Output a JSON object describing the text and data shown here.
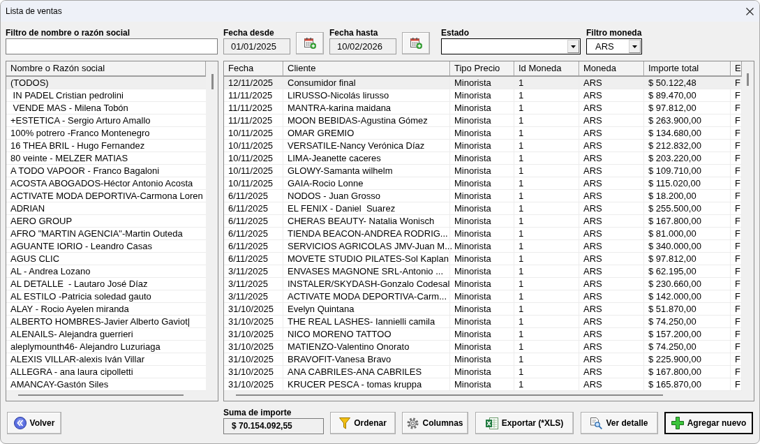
{
  "window": {
    "title": "Lista de ventas"
  },
  "filters": {
    "name": {
      "label": "Filtro de nombre o razón social"
    },
    "date_from": {
      "label": "Fecha desde",
      "value": "01/01/2025"
    },
    "date_to": {
      "label": "Fecha hasta",
      "value": "10/02/2026"
    },
    "status": {
      "label": "Estado"
    },
    "currency": {
      "label": "Filtro moneda",
      "value": "ARS"
    }
  },
  "clients_list": {
    "header": "Nombre o Razón social",
    "items": [
      {
        "name": "(TODOS)",
        "selected": true
      },
      {
        "name": " IN PADEL Cristian pedrolini",
        "selected": false
      },
      {
        "name": " VENDE MAS - Milena Tobón",
        "selected": false
      },
      {
        "name": "+ESTETICA - Sergio Arturo Amallo",
        "selected": false
      },
      {
        "name": "100% potrero -Franco Montenegro",
        "selected": false
      },
      {
        "name": "16 THEA BRIL - Hugo Fernandez",
        "selected": false
      },
      {
        "name": "80 veinte - MELZER MATIAS",
        "selected": false
      },
      {
        "name": "A TODO VAPOOR - Franco Bagaloni",
        "selected": false
      },
      {
        "name": "ACOSTA ABOGADOS-Héctor Antonio Acosta",
        "selected": false
      },
      {
        "name": "ACTIVATE MODA DEPORTIVA-Carmona Loren",
        "selected": false
      },
      {
        "name": "ADRIAN",
        "selected": false
      },
      {
        "name": "AERO GROUP",
        "selected": false
      },
      {
        "name": "AFRO \"MARTIN AGENCIA\"-Martin Outeda",
        "selected": false
      },
      {
        "name": "AGUANTE IORIO - Leandro Casas",
        "selected": false
      },
      {
        "name": "AGUS CLIC",
        "selected": false
      },
      {
        "name": "AL - Andrea Lozano",
        "selected": false
      },
      {
        "name": "AL DETALLE  - Lautaro José Díaz",
        "selected": false
      },
      {
        "name": "AL ESTILO -Patricia soledad gauto",
        "selected": false
      },
      {
        "name": "ALAY - Rocio Ayelen miranda",
        "selected": false
      },
      {
        "name": "ALBERTO HOMBRES-Javier Alberto Gaviot|",
        "selected": false
      },
      {
        "name": "ALENAILS- Alejandra guerrieri",
        "selected": false
      },
      {
        "name": "aleplymounth46- Alejandro Luzuriaga",
        "selected": false
      },
      {
        "name": "ALEXIS VILLAR-alexis Iván Villar",
        "selected": false
      },
      {
        "name": "ALLEGRA - ana laura cipolletti",
        "selected": false
      },
      {
        "name": "AMANCAY-Gastón Siles",
        "selected": false
      }
    ]
  },
  "sales_table": {
    "columns": [
      "Fecha",
      "Cliente",
      "Tipo Precio",
      "Id Moneda",
      "Moneda",
      "Importe total",
      "E"
    ],
    "rows": [
      {
        "cells": [
          "12/11/2025",
          "Consumidor final",
          "Minorista",
          "1",
          "ARS",
          "$ 50.122,48",
          "F"
        ],
        "selected": true
      },
      {
        "cells": [
          "11/11/2025",
          "LIRUSSO-Nicolás lirusso",
          "Minorista",
          "1",
          "ARS",
          "$ 89.470,00",
          "F"
        ],
        "selected": false
      },
      {
        "cells": [
          "11/11/2025",
          "MANTRA-karina maidana",
          "Minorista",
          "1",
          "ARS",
          "$ 97.812,00",
          "F"
        ],
        "selected": false
      },
      {
        "cells": [
          "11/11/2025",
          "MOON BEBIDAS-Agustina Gómez",
          "Minorista",
          "1",
          "ARS",
          "$ 263.900,00",
          "F"
        ],
        "selected": false
      },
      {
        "cells": [
          "10/11/2025",
          "OMAR GREMIO",
          "Minorista",
          "1",
          "ARS",
          "$ 134.680,00",
          "F"
        ],
        "selected": false
      },
      {
        "cells": [
          "10/11/2025",
          "VERSATILE-Nancy Verónica Díaz",
          "Minorista",
          "1",
          "ARS",
          "$ 212.832,00",
          "F"
        ],
        "selected": false
      },
      {
        "cells": [
          "10/11/2025",
          "LIMA-Jeanette caceres",
          "Minorista",
          "1",
          "ARS",
          "$ 203.220,00",
          "F"
        ],
        "selected": false
      },
      {
        "cells": [
          "10/11/2025",
          "GLOWY-Samanta wilhelm",
          "Minorista",
          "1",
          "ARS",
          "$ 109.710,00",
          "F"
        ],
        "selected": false
      },
      {
        "cells": [
          "10/11/2025",
          "GAIA-Rocio Lonne",
          "Minorista",
          "1",
          "ARS",
          "$ 115.020,00",
          "F"
        ],
        "selected": false
      },
      {
        "cells": [
          "6/11/2025",
          "NODOS - Juan Grosso",
          "Minorista",
          "1",
          "ARS",
          "$ 18.200,00",
          "F"
        ],
        "selected": false
      },
      {
        "cells": [
          "6/11/2025",
          "EL FENIX - Daniel  Suarez",
          "Minorista",
          "1",
          "ARS",
          "$ 255.500,00",
          "F"
        ],
        "selected": false
      },
      {
        "cells": [
          "6/11/2025",
          "CHERAS BEAUTY- Natalia Wonisch",
          "Minorista",
          "1",
          "ARS",
          "$ 167.800,00",
          "F"
        ],
        "selected": false
      },
      {
        "cells": [
          "6/11/2025",
          "TIENDA BEACON-ANDREA RODRIG...",
          "Minorista",
          "1",
          "ARS",
          "$ 81.000,00",
          "F"
        ],
        "selected": false
      },
      {
        "cells": [
          "6/11/2025",
          "SERVICIOS AGRICOLAS JMV-Juan M...",
          "Minorista",
          "1",
          "ARS",
          "$ 340.000,00",
          "F"
        ],
        "selected": false
      },
      {
        "cells": [
          "6/11/2025",
          "MOVETE STUDIO PILATES-Sol Kaplan",
          "Minorista",
          "1",
          "ARS",
          "$ 97.812,00",
          "F"
        ],
        "selected": false
      },
      {
        "cells": [
          "3/11/2025",
          "ENVASES MAGNONE SRL-Antonio ...",
          "Minorista",
          "1",
          "ARS",
          "$ 62.195,00",
          "F"
        ],
        "selected": false
      },
      {
        "cells": [
          "3/11/2025",
          "INSTALER/SKYDASH-Gonzalo Codesal",
          "Minorista",
          "1",
          "ARS",
          "$ 230.660,00",
          "F"
        ],
        "selected": false
      },
      {
        "cells": [
          "3/11/2025",
          "ACTIVATE MODA DEPORTIVA-Carm...",
          "Minorista",
          "1",
          "ARS",
          "$ 142.000,00",
          "F"
        ],
        "selected": false
      },
      {
        "cells": [
          "31/10/2025",
          "Evelyn Quintana",
          "Minorista",
          "1",
          "ARS",
          "$ 51.870,00",
          "F"
        ],
        "selected": false
      },
      {
        "cells": [
          "31/10/2025",
          "THE REAL LASHES- Iannielli camila",
          "Minorista",
          "1",
          "ARS",
          "$ 74.250,00",
          "F"
        ],
        "selected": false
      },
      {
        "cells": [
          "31/10/2025",
          "NICO MORENO TATTOO",
          "Minorista",
          "1",
          "ARS",
          "$ 157.200,00",
          "F"
        ],
        "selected": false
      },
      {
        "cells": [
          "31/10/2025",
          "MATIENZO-Valentino Onorato",
          "Minorista",
          "1",
          "ARS",
          "$ 74.250,00",
          "F"
        ],
        "selected": false
      },
      {
        "cells": [
          "31/10/2025",
          "BRAVOFIT-Vanesa Bravo",
          "Minorista",
          "1",
          "ARS",
          "$ 225.900,00",
          "F"
        ],
        "selected": false
      },
      {
        "cells": [
          "31/10/2025",
          "ANA CABRILES-ANA CABRILES",
          "Minorista",
          "1",
          "ARS",
          "$ 167.800,00",
          "F"
        ],
        "selected": false
      },
      {
        "cells": [
          "31/10/2025",
          "KRUCER PESCA - tomas kruppa",
          "Minorista",
          "1",
          "ARS",
          "$ 165.870,00",
          "F"
        ],
        "selected": false
      }
    ]
  },
  "footer": {
    "back_button": {
      "label": "Volver",
      "kind": "back",
      "default": false
    },
    "summary": {
      "label": "Suma de importe",
      "value": "$ 70.154.092,55"
    },
    "buttons": [
      {
        "label": "Ordenar",
        "kind": "sort",
        "default": false
      },
      {
        "label": "Columnas",
        "kind": "columns",
        "default": false
      },
      {
        "label": "Exportar (*XLS)",
        "kind": "export",
        "default": false
      },
      {
        "label": "Ver detalle",
        "kind": "details",
        "default": false
      },
      {
        "label": "Agregar nuevo",
        "kind": "add",
        "default": true
      }
    ]
  }
}
